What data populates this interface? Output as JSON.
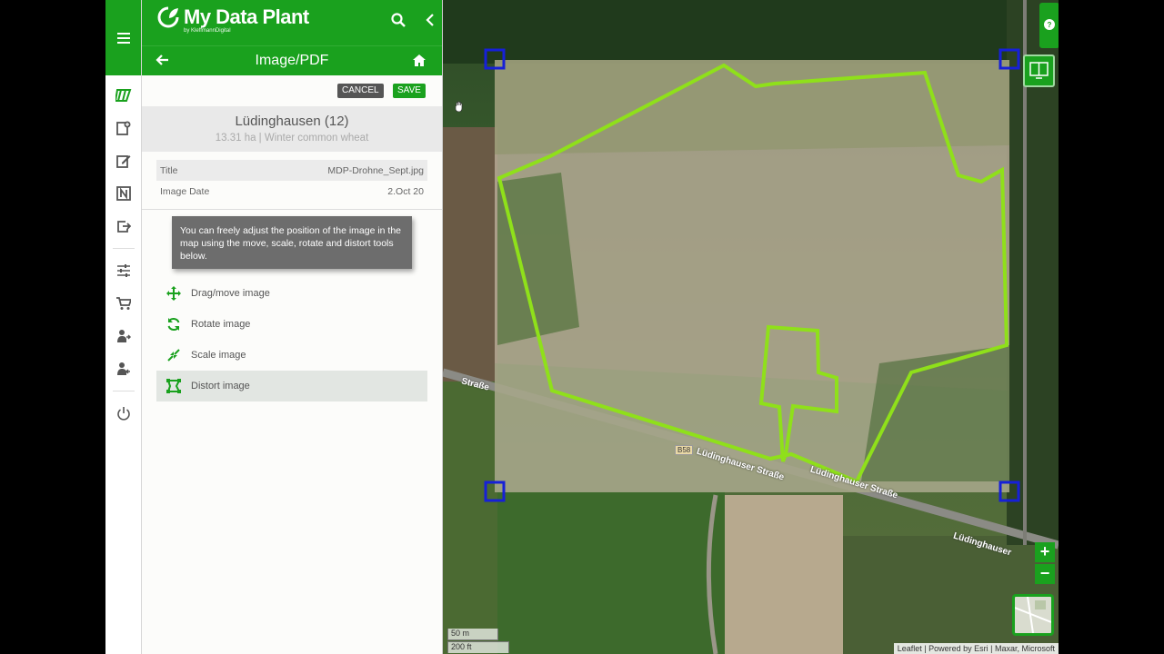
{
  "app": {
    "name": "My Data Plant",
    "byline": "by KleffmannDigital"
  },
  "header": {
    "title": "Image/PDF"
  },
  "actions": {
    "cancel": "CANCEL",
    "save": "SAVE"
  },
  "field": {
    "name": "Lüdinghausen (12)",
    "meta": "13.31 ha | Winter common wheat"
  },
  "info": [
    {
      "label": "Title",
      "value": "MDP-Drohne_Sept.jpg"
    },
    {
      "label": "Image Date",
      "value": "2.Oct 20"
    }
  ],
  "tooltip": "You can freely adjust the position of the image in the map using the move, scale, rotate and distort tools below.",
  "tools": [
    {
      "label": "Drag/move image",
      "icon": "move-icon",
      "active": false
    },
    {
      "label": "Rotate image",
      "icon": "rotate-icon",
      "active": false
    },
    {
      "label": "Scale image",
      "icon": "scale-icon",
      "active": false
    },
    {
      "label": "Distort image",
      "icon": "distort-icon",
      "active": true
    }
  ],
  "map": {
    "labels": [
      "Straße",
      "B58",
      "Lüdinghauser Straße",
      "Lüdinghauser Straße",
      "Lüdinghauser"
    ],
    "scale": {
      "metric": "50 m",
      "imperial": "200 ft"
    },
    "attribution": "Leaflet | Powered by Esri | Maxar, Microsoft",
    "zoom_in": "+",
    "zoom_out": "−",
    "panel_badge": "1|2"
  },
  "colors": {
    "brand": "#1aa11e",
    "field_outline": "#8fe01a",
    "handles": "#1620d8"
  }
}
